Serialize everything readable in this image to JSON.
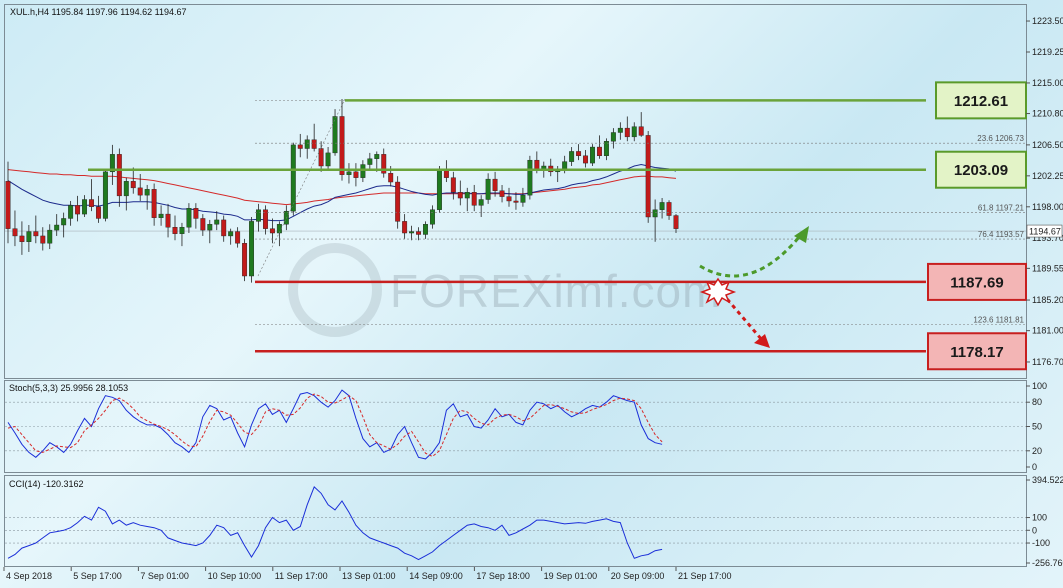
{
  "chart_data": {
    "type": "candlestick",
    "symbol_header": "XUL.h,H4  1195.84 1197.96 1194.62 1194.67",
    "price_ticks": [
      "1223.50",
      "1219.25",
      "1215.00",
      "1210.80",
      "1206.50",
      "1202.25",
      "1198.00",
      "1193.70",
      "1189.55",
      "1185.20",
      "1181.00",
      "1176.70"
    ],
    "current_price_label": "1194.67",
    "ylim": [
      1174.5,
      1225.7
    ],
    "date_ticks": [
      "4 Sep 2018",
      "5 Sep 17:00",
      "7 Sep 01:00",
      "10 Sep 10:00",
      "11 Sep 17:00",
      "13 Sep 01:00",
      "14 Sep 09:00",
      "17 Sep 18:00",
      "19 Sep 01:00",
      "20 Sep 09:00",
      "21 Sep 17:00"
    ],
    "levels": [
      {
        "label": "1212.61",
        "value": 1212.61,
        "kind": "resistance"
      },
      {
        "label": "1203.09",
        "value": 1203.09,
        "kind": "resistance"
      },
      {
        "label": "1187.69",
        "value": 1187.69,
        "kind": "support"
      },
      {
        "label": "1178.17",
        "value": 1178.17,
        "kind": "support"
      }
    ],
    "fib_labels": [
      {
        "label": "23.6 1206.73",
        "value": 1206.73
      },
      {
        "label": "61.8 1197.21",
        "value": 1197.21
      },
      {
        "label": "76.4 1193.57",
        "value": 1193.57
      },
      {
        "label": "123.6 1181.81",
        "value": 1181.81
      }
    ],
    "candles": [
      [
        1201.5,
        1204.2,
        1193.0,
        1195.0
      ],
      [
        1195.0,
        1197.5,
        1192.6,
        1194.0
      ],
      [
        1194.0,
        1196.0,
        1191.4,
        1193.2
      ],
      [
        1193.2,
        1195.5,
        1191.8,
        1194.6
      ],
      [
        1194.6,
        1196.8,
        1193.0,
        1194.0
      ],
      [
        1194.0,
        1195.2,
        1192.0,
        1193.0
      ],
      [
        1193.0,
        1195.6,
        1192.2,
        1194.8
      ],
      [
        1194.8,
        1197.0,
        1194.0,
        1195.5
      ],
      [
        1195.5,
        1197.2,
        1193.8,
        1196.4
      ],
      [
        1196.4,
        1198.8,
        1195.4,
        1198.2
      ],
      [
        1198.2,
        1199.5,
        1196.0,
        1197.0
      ],
      [
        1197.0,
        1199.6,
        1196.6,
        1199.0
      ],
      [
        1199.0,
        1201.8,
        1197.4,
        1198.0
      ],
      [
        1198.0,
        1199.5,
        1195.8,
        1196.4
      ],
      [
        1196.4,
        1203.2,
        1196.0,
        1202.8
      ],
      [
        1202.8,
        1206.5,
        1201.0,
        1205.2
      ],
      [
        1205.2,
        1206.0,
        1198.0,
        1199.5
      ],
      [
        1199.5,
        1202.0,
        1197.5,
        1201.5
      ],
      [
        1201.5,
        1203.4,
        1199.8,
        1200.6
      ],
      [
        1200.6,
        1202.5,
        1198.8,
        1199.6
      ],
      [
        1199.6,
        1201.0,
        1197.6,
        1200.4
      ],
      [
        1200.4,
        1201.2,
        1195.4,
        1196.5
      ],
      [
        1196.5,
        1198.2,
        1195.4,
        1197.0
      ],
      [
        1197.0,
        1198.4,
        1193.8,
        1195.2
      ],
      [
        1195.2,
        1196.8,
        1193.4,
        1194.3
      ],
      [
        1194.3,
        1195.8,
        1192.6,
        1195.2
      ],
      [
        1195.2,
        1198.5,
        1194.4,
        1197.8
      ],
      [
        1197.8,
        1198.5,
        1195.0,
        1196.4
      ],
      [
        1196.4,
        1197.0,
        1194.0,
        1194.8
      ],
      [
        1194.8,
        1196.2,
        1193.0,
        1195.6
      ],
      [
        1195.6,
        1197.4,
        1194.8,
        1196.2
      ],
      [
        1196.2,
        1196.8,
        1193.2,
        1194.0
      ],
      [
        1194.0,
        1195.0,
        1192.8,
        1194.6
      ],
      [
        1194.6,
        1195.2,
        1192.4,
        1193.0
      ],
      [
        1193.0,
        1193.6,
        1187.8,
        1188.5
      ],
      [
        1188.5,
        1196.6,
        1187.6,
        1196.0
      ],
      [
        1196.0,
        1198.4,
        1194.6,
        1197.6
      ],
      [
        1197.6,
        1198.2,
        1194.2,
        1195.0
      ],
      [
        1195.0,
        1196.4,
        1193.0,
        1194.4
      ],
      [
        1194.4,
        1196.0,
        1192.6,
        1195.6
      ],
      [
        1195.6,
        1198.2,
        1194.8,
        1197.4
      ],
      [
        1197.4,
        1206.8,
        1196.8,
        1206.5
      ],
      [
        1206.5,
        1208.0,
        1204.8,
        1206.0
      ],
      [
        1206.0,
        1207.8,
        1204.6,
        1207.2
      ],
      [
        1207.2,
        1209.4,
        1205.6,
        1206.0
      ],
      [
        1206.0,
        1207.0,
        1202.8,
        1203.6
      ],
      [
        1203.6,
        1206.2,
        1203.0,
        1205.4
      ],
      [
        1205.4,
        1211.4,
        1205.0,
        1210.4
      ],
      [
        1210.4,
        1212.8,
        1201.6,
        1202.4
      ],
      [
        1202.4,
        1204.0,
        1201.2,
        1202.8
      ],
      [
        1202.8,
        1204.0,
        1200.8,
        1202.0
      ],
      [
        1202.0,
        1204.4,
        1201.4,
        1203.8
      ],
      [
        1203.8,
        1205.4,
        1203.0,
        1204.6
      ],
      [
        1204.6,
        1205.6,
        1202.8,
        1205.2
      ],
      [
        1205.2,
        1206.0,
        1202.0,
        1202.6
      ],
      [
        1202.6,
        1203.6,
        1200.8,
        1201.4
      ],
      [
        1201.4,
        1202.2,
        1195.0,
        1196.0
      ],
      [
        1196.0,
        1197.0,
        1193.6,
        1194.4
      ],
      [
        1194.4,
        1195.4,
        1193.4,
        1194.6
      ],
      [
        1194.6,
        1195.2,
        1193.4,
        1194.2
      ],
      [
        1194.2,
        1196.0,
        1193.6,
        1195.6
      ],
      [
        1195.6,
        1198.2,
        1195.0,
        1197.6
      ],
      [
        1197.6,
        1203.6,
        1197.2,
        1203.0
      ],
      [
        1203.0,
        1204.4,
        1201.4,
        1202.0
      ],
      [
        1202.0,
        1202.8,
        1199.0,
        1200.0
      ],
      [
        1200.0,
        1201.6,
        1198.2,
        1199.2
      ],
      [
        1199.2,
        1200.6,
        1197.4,
        1200.0
      ],
      [
        1200.0,
        1201.0,
        1197.4,
        1198.2
      ],
      [
        1198.2,
        1199.6,
        1196.6,
        1199.0
      ],
      [
        1199.0,
        1202.6,
        1198.4,
        1201.8
      ],
      [
        1201.8,
        1202.8,
        1199.4,
        1200.2
      ],
      [
        1200.2,
        1201.0,
        1198.6,
        1199.4
      ],
      [
        1199.4,
        1200.6,
        1198.0,
        1198.8
      ],
      [
        1198.8,
        1200.0,
        1197.6,
        1198.6
      ],
      [
        1198.6,
        1200.6,
        1198.0,
        1199.6
      ],
      [
        1199.6,
        1205.0,
        1199.0,
        1204.4
      ],
      [
        1204.4,
        1205.6,
        1202.6,
        1203.2
      ],
      [
        1203.2,
        1204.2,
        1202.0,
        1203.6
      ],
      [
        1203.6,
        1204.6,
        1202.2,
        1202.8
      ],
      [
        1202.8,
        1203.6,
        1201.4,
        1203.0
      ],
      [
        1203.0,
        1205.0,
        1202.6,
        1204.2
      ],
      [
        1204.2,
        1206.2,
        1203.6,
        1205.6
      ],
      [
        1205.6,
        1206.6,
        1204.4,
        1205.0
      ],
      [
        1205.0,
        1205.8,
        1203.4,
        1204.0
      ],
      [
        1204.0,
        1206.6,
        1203.6,
        1206.2
      ],
      [
        1206.2,
        1207.8,
        1204.6,
        1205.0
      ],
      [
        1205.0,
        1207.4,
        1204.4,
        1207.0
      ],
      [
        1207.0,
        1208.8,
        1206.0,
        1208.2
      ],
      [
        1208.2,
        1209.6,
        1207.2,
        1208.8
      ],
      [
        1208.8,
        1210.4,
        1207.0,
        1207.6
      ],
      [
        1207.6,
        1209.6,
        1207.0,
        1209.0
      ],
      [
        1209.0,
        1211.0,
        1207.6,
        1207.8
      ],
      [
        1207.8,
        1208.4,
        1195.8,
        1196.6
      ],
      [
        1196.6,
        1199.0,
        1193.2,
        1197.6
      ],
      [
        1197.6,
        1199.2,
        1196.4,
        1198.6
      ],
      [
        1198.6,
        1198.9,
        1196.2,
        1196.8
      ],
      [
        1196.8,
        1197.0,
        1194.4,
        1195.0
      ]
    ],
    "ema_blue": [
      1201.6,
      1201.0,
      1200.4,
      1199.9,
      1199.4,
      1198.9,
      1198.6,
      1198.4,
      1198.2,
      1198.2,
      1198.1,
      1198.2,
      1198.2,
      1198.1,
      1198.3,
      1198.6,
      1198.6,
      1198.6,
      1198.7,
      1198.7,
      1198.7,
      1198.6,
      1198.4,
      1198.2,
      1197.9,
      1197.7,
      1197.7,
      1197.6,
      1197.4,
      1197.3,
      1197.2,
      1197.0,
      1196.9,
      1196.7,
      1196.2,
      1196.2,
      1196.3,
      1196.2,
      1196.1,
      1196.1,
      1196.2,
      1196.7,
      1197.2,
      1197.7,
      1198.1,
      1198.3,
      1198.7,
      1199.3,
      1199.5,
      1199.7,
      1199.9,
      1200.2,
      1200.5,
      1200.8,
      1200.9,
      1200.9,
      1200.7,
      1200.4,
      1200.1,
      1199.9,
      1199.7,
      1199.6,
      1199.8,
      1199.9,
      1199.9,
      1199.9,
      1199.9,
      1199.8,
      1199.8,
      1199.9,
      1199.9,
      1199.9,
      1199.8,
      1199.7,
      1199.7,
      1199.9,
      1200.1,
      1200.3,
      1200.4,
      1200.5,
      1200.7,
      1201.0,
      1201.2,
      1201.3,
      1201.6,
      1201.8,
      1202.1,
      1202.5,
      1202.9,
      1203.2,
      1203.6,
      1203.8,
      1203.6,
      1203.4,
      1203.3,
      1203.2,
      1202.9
    ],
    "ema_red": [
      1203.1,
      1203.0,
      1202.9,
      1202.8,
      1202.7,
      1202.6,
      1202.5,
      1202.5,
      1202.4,
      1202.4,
      1202.3,
      1202.3,
      1202.2,
      1202.2,
      1202.2,
      1202.2,
      1202.1,
      1202.0,
      1201.9,
      1201.8,
      1201.7,
      1201.6,
      1201.4,
      1201.2,
      1201.0,
      1200.8,
      1200.6,
      1200.4,
      1200.2,
      1200.0,
      1199.8,
      1199.6,
      1199.4,
      1199.2,
      1198.9,
      1198.8,
      1198.7,
      1198.6,
      1198.5,
      1198.4,
      1198.3,
      1198.4,
      1198.5,
      1198.6,
      1198.8,
      1198.9,
      1199.0,
      1199.2,
      1199.3,
      1199.4,
      1199.5,
      1199.6,
      1199.7,
      1199.8,
      1199.9,
      1199.9,
      1199.9,
      1199.9,
      1199.9,
      1199.9,
      1199.8,
      1199.8,
      1199.8,
      1199.8,
      1199.8,
      1199.8,
      1199.8,
      1199.8,
      1199.8,
      1199.8,
      1199.8,
      1199.8,
      1199.8,
      1199.8,
      1199.8,
      1199.9,
      1200.0,
      1200.1,
      1200.2,
      1200.3,
      1200.4,
      1200.6,
      1200.7,
      1200.8,
      1201.0,
      1201.1,
      1201.3,
      1201.5,
      1201.7,
      1201.9,
      1202.1,
      1202.2,
      1202.2,
      1202.1,
      1202.1,
      1202.0,
      1201.9
    ],
    "stoch": {
      "header": "Stoch(5,3,3) 25.9956 28.1053",
      "levels_labels": [
        "100",
        "80",
        "50",
        "20",
        "0"
      ],
      "ylim": [
        0,
        100
      ],
      "k": [
        55,
        42,
        28,
        18,
        12,
        20,
        30,
        25,
        18,
        28,
        45,
        60,
        50,
        72,
        88,
        86,
        82,
        70,
        62,
        56,
        52,
        52,
        48,
        40,
        30,
        25,
        18,
        30,
        62,
        76,
        72,
        58,
        62,
        42,
        25,
        52,
        72,
        78,
        65,
        70,
        55,
        72,
        90,
        92,
        88,
        80,
        74,
        82,
        95,
        88,
        60,
        35,
        25,
        30,
        18,
        22,
        40,
        50,
        30,
        12,
        10,
        18,
        30,
        70,
        78,
        62,
        65,
        50,
        48,
        58,
        72,
        62,
        65,
        55,
        52,
        70,
        80,
        78,
        72,
        76,
        68,
        62,
        66,
        72,
        76,
        74,
        80,
        88,
        85,
        82,
        80,
        52,
        35,
        30,
        28
      ],
      "d": [
        48,
        50,
        40,
        30,
        20,
        18,
        22,
        26,
        25,
        24,
        30,
        45,
        52,
        60,
        70,
        82,
        85,
        80,
        72,
        62,
        57,
        53,
        50,
        46,
        40,
        32,
        26,
        25,
        38,
        56,
        70,
        68,
        64,
        54,
        43,
        40,
        50,
        68,
        72,
        70,
        64,
        65,
        73,
        85,
        90,
        87,
        80,
        79,
        83,
        88,
        82,
        62,
        40,
        30,
        26,
        22,
        28,
        38,
        44,
        31,
        17,
        13,
        20,
        40,
        60,
        70,
        68,
        60,
        54,
        52,
        60,
        64,
        65,
        62,
        57,
        60,
        68,
        76,
        77,
        75,
        72,
        68,
        66,
        67,
        71,
        74,
        77,
        82,
        85,
        84,
        82,
        72,
        55,
        40,
        31
      ]
    },
    "cci": {
      "header": "CCI(14) -120.3162",
      "levels_labels": [
        "394.522",
        "100",
        "0",
        "-100",
        "-256.760"
      ],
      "ylim": [
        -256.76,
        394.522
      ],
      "values": [
        -220,
        -190,
        -140,
        -120,
        -100,
        -60,
        -20,
        -10,
        0,
        20,
        60,
        110,
        80,
        180,
        150,
        50,
        80,
        40,
        60,
        40,
        30,
        20,
        0,
        -60,
        -80,
        -100,
        -110,
        -120,
        -100,
        -40,
        40,
        20,
        -40,
        -20,
        -120,
        -210,
        -120,
        20,
        100,
        60,
        80,
        0,
        30,
        200,
        340,
        290,
        200,
        160,
        230,
        140,
        40,
        -20,
        -60,
        -80,
        -100,
        -120,
        -140,
        -180,
        -200,
        -230,
        -200,
        -170,
        -120,
        -80,
        -40,
        0,
        40,
        50,
        30,
        20,
        0,
        40,
        -40,
        -20,
        10,
        40,
        80,
        80,
        70,
        60,
        50,
        55,
        60,
        55,
        70,
        80,
        90,
        70,
        60,
        -100,
        -220,
        -200,
        -190,
        -160,
        -150
      ]
    }
  },
  "watermark": "FOREXimf.com"
}
